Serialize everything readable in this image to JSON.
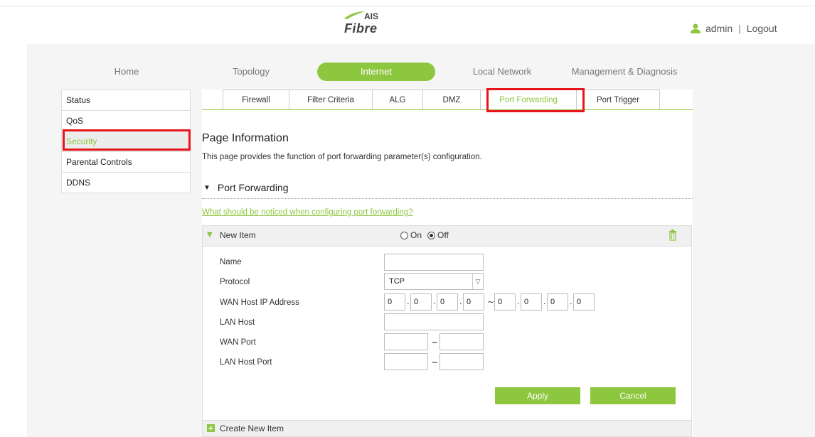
{
  "brand": {
    "logo_top": "AIS",
    "logo_bottom": "Fibre"
  },
  "user": {
    "name": "admin",
    "separator": "|",
    "logout_label": "Logout"
  },
  "nav": {
    "items": [
      {
        "label": "Home"
      },
      {
        "label": "Topology"
      },
      {
        "label": "Internet",
        "active": true
      },
      {
        "label": "Local Network"
      },
      {
        "label": "Management & Diagnosis"
      }
    ]
  },
  "sidebar": {
    "items": [
      {
        "label": "Status"
      },
      {
        "label": "QoS"
      },
      {
        "label": "Security",
        "active": true
      },
      {
        "label": "Parental Controls"
      },
      {
        "label": "DDNS"
      }
    ]
  },
  "subtabs": {
    "items": [
      {
        "label": "Firewall"
      },
      {
        "label": "Filter Criteria"
      },
      {
        "label": "ALG"
      },
      {
        "label": "DMZ"
      },
      {
        "label": "Port Forwarding",
        "active": true
      },
      {
        "label": "Port Trigger"
      }
    ]
  },
  "page": {
    "title": "Page Information",
    "description": "This page provides the function of port forwarding parameter(s) configuration."
  },
  "section": {
    "title": "Port Forwarding",
    "notice_link": "What should be noticed when configuring port forwarding?"
  },
  "item": {
    "title": "New Item",
    "radio_on": "On",
    "radio_off": "Off",
    "selected": "Off"
  },
  "form": {
    "name_label": "Name",
    "name_value": "",
    "protocol_label": "Protocol",
    "protocol_value": "TCP",
    "wan_ip_label": "WAN Host IP Address",
    "wan_ip_start": [
      "0",
      "0",
      "0",
      "0"
    ],
    "wan_ip_end": [
      "0",
      "0",
      "0",
      "0"
    ],
    "ip_dot": ".",
    "range_sep": "~",
    "lan_host_label": "LAN Host",
    "lan_host_value": "",
    "wan_port_label": "WAN Port",
    "lan_host_port_label": "LAN Host Port",
    "apply_label": "Apply",
    "cancel_label": "Cancel"
  },
  "create": {
    "label": "Create New Item"
  },
  "colors": {
    "accent": "#8dc63f",
    "highlight": "#e8141b"
  }
}
